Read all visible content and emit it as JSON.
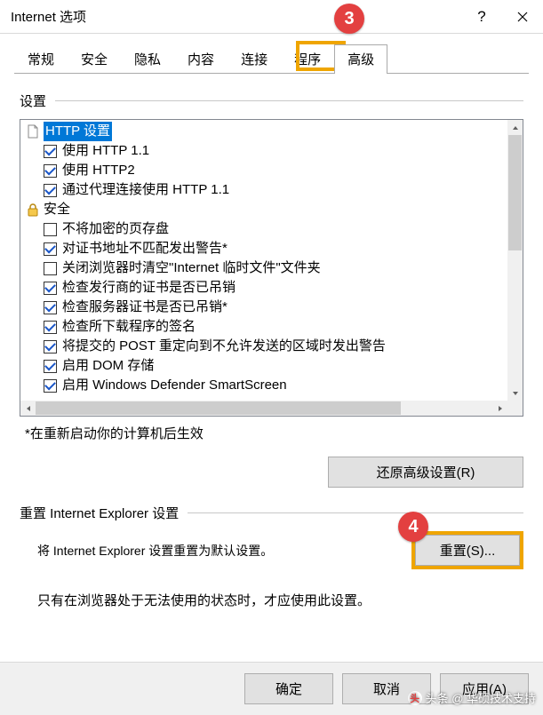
{
  "window": {
    "title": "Internet 选项"
  },
  "tabs": [
    "常规",
    "安全",
    "隐私",
    "内容",
    "连接",
    "程序",
    "高级"
  ],
  "active_tab_index": 6,
  "annotations": {
    "badge3": "3",
    "badge4": "4"
  },
  "settings": {
    "group_label": "设置",
    "tree": [
      {
        "level": 1,
        "type": "header",
        "icon": "page-icon",
        "label": "HTTP 设置",
        "selected": true
      },
      {
        "level": 2,
        "type": "check",
        "checked": true,
        "label": "使用 HTTP 1.1"
      },
      {
        "level": 2,
        "type": "check",
        "checked": true,
        "label": "使用 HTTP2"
      },
      {
        "level": 2,
        "type": "check",
        "checked": true,
        "label": "通过代理连接使用 HTTP 1.1"
      },
      {
        "level": 1,
        "type": "header",
        "icon": "lock-icon",
        "label": "安全"
      },
      {
        "level": 2,
        "type": "check",
        "checked": false,
        "label": "不将加密的页存盘"
      },
      {
        "level": 2,
        "type": "check",
        "checked": true,
        "label": "对证书地址不匹配发出警告*"
      },
      {
        "level": 2,
        "type": "check",
        "checked": false,
        "label": "关闭浏览器时清空\"Internet 临时文件\"文件夹"
      },
      {
        "level": 2,
        "type": "check",
        "checked": true,
        "label": "检查发行商的证书是否已吊销"
      },
      {
        "level": 2,
        "type": "check",
        "checked": true,
        "label": "检查服务器证书是否已吊销*"
      },
      {
        "level": 2,
        "type": "check",
        "checked": true,
        "label": "检查所下载程序的签名"
      },
      {
        "level": 2,
        "type": "check",
        "checked": true,
        "label": "将提交的 POST 重定向到不允许发送的区域时发出警告"
      },
      {
        "level": 2,
        "type": "check",
        "checked": true,
        "label": "启用 DOM 存储"
      },
      {
        "level": 2,
        "type": "check",
        "checked": true,
        "label": "启用 Windows Defender SmartScreen"
      }
    ],
    "restart_note": "*在重新启动你的计算机后生效",
    "restore_button": "还原高级设置(R)"
  },
  "reset": {
    "group_label": "重置 Internet Explorer 设置",
    "desc": "将 Internet Explorer 设置重置为默认设置。",
    "button": "重置(S)...",
    "hint": "只有在浏览器处于无法使用的状态时，才应使用此设置。"
  },
  "footer": {
    "ok": "确定",
    "cancel": "取消",
    "apply": "应用(A)"
  },
  "watermark": "头条 @ 华硕技术支持"
}
